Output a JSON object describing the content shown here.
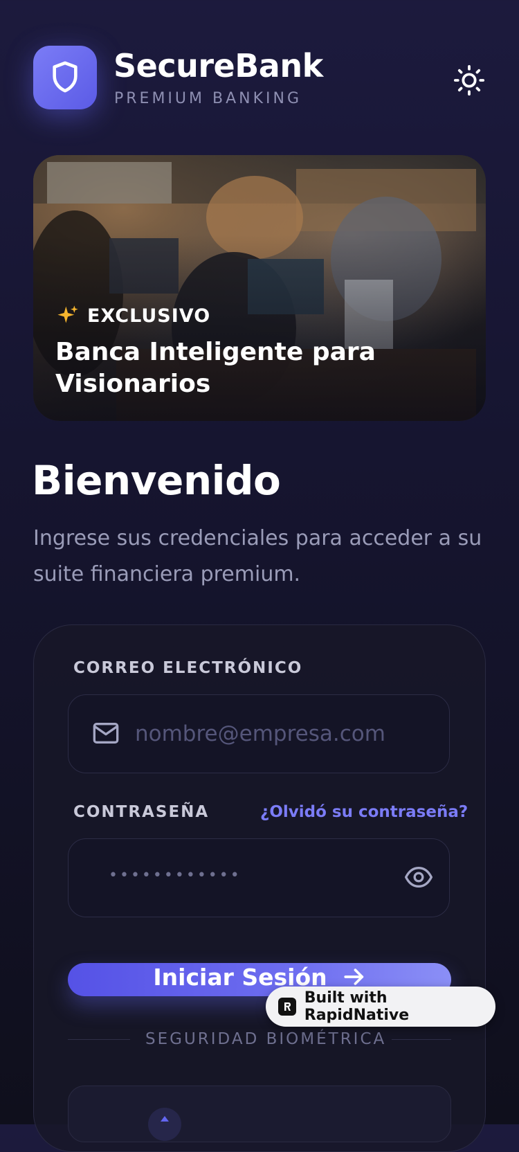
{
  "header": {
    "brand_name": "SecureBank",
    "brand_subtitle": "PREMIUM BANKING",
    "logo_icon": "shield-icon",
    "theme_icon": "sun-icon"
  },
  "hero": {
    "tag": "EXCLUSIVO",
    "tag_icon": "sparkles-icon",
    "title": "Banca Inteligente para Visionarios"
  },
  "welcome": {
    "title": "Bienvenido",
    "subtitle": "Ingrese sus credenciales para acceder a su suite financiera premium."
  },
  "form": {
    "email_label": "CORREO ELECTRÓNICO",
    "email_placeholder": "nombre@empresa.com",
    "password_label": "CONTRASEÑA",
    "forgot_link": "¿Olvidó su contraseña?",
    "password_value": "••••••••••••",
    "submit_label": "Iniciar Sesión",
    "divider_label": "SEGURIDAD BIOMÉTRICA"
  },
  "badge": {
    "text": "Built with RapidNative"
  },
  "colors": {
    "accent": "#6366f1",
    "link": "#7b7cf6",
    "background": "#161530"
  }
}
